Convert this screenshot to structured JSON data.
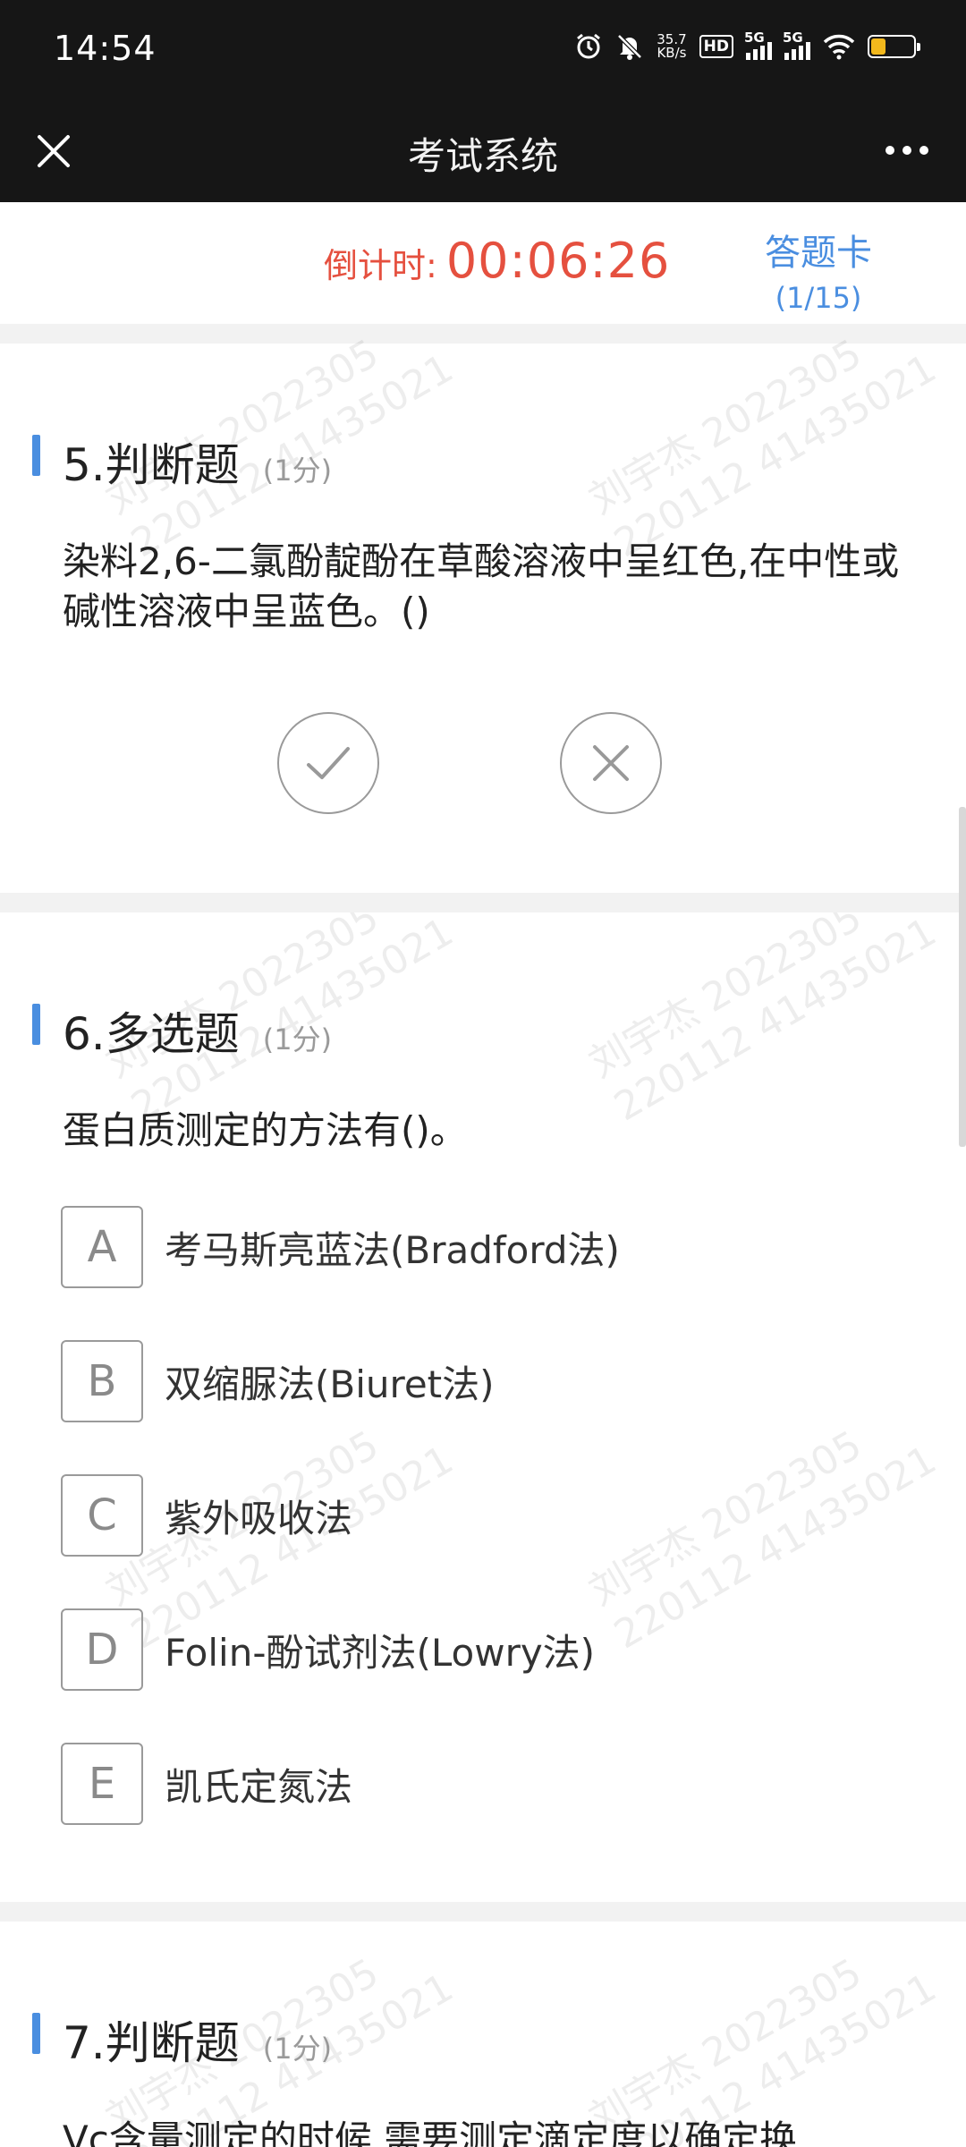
{
  "status_bar": {
    "time": "14:54",
    "net_speed_value": "35.7",
    "net_speed_unit": "KB/s",
    "hd_label": "HD",
    "sim1_label": "5G",
    "sim2_label": "5G",
    "battery_color": "#f2b81c"
  },
  "header": {
    "title": "考试系统"
  },
  "timer": {
    "label": "倒计时:",
    "value": "00:06:26"
  },
  "answer_card": {
    "label": "答题卡",
    "progress": "(1/15)"
  },
  "watermark": {
    "line1": "刘宇杰 2022305",
    "line2": "220112 41435021"
  },
  "questions": [
    {
      "title": "5.判断题",
      "score": "(1分)",
      "text": "染料2,6-二氯酚靛酚在草酸溶液中呈红色,在中性或碱性溶液中呈蓝色。()"
    },
    {
      "title": "6.多选题",
      "score": "(1分)",
      "text": "蛋白质测定的方法有()。",
      "options": [
        {
          "letter": "A",
          "text": "考马斯亮蓝法(Bradford法)"
        },
        {
          "letter": "B",
          "text": "双缩脲法(Biuret法)"
        },
        {
          "letter": "C",
          "text": "紫外吸收法"
        },
        {
          "letter": "D",
          "text": "Folin-酚试剂法(Lowry法)"
        },
        {
          "letter": "E",
          "text": "凯氏定氮法"
        }
      ]
    },
    {
      "title": "7.判断题",
      "score": "(1分)",
      "text": "Vc含量测定的时候,需要测定滴定度以确定换"
    }
  ],
  "colors": {
    "accent_blue": "#4a8ee0",
    "timer_red": "#e5503f",
    "bar_dark": "#161616"
  }
}
